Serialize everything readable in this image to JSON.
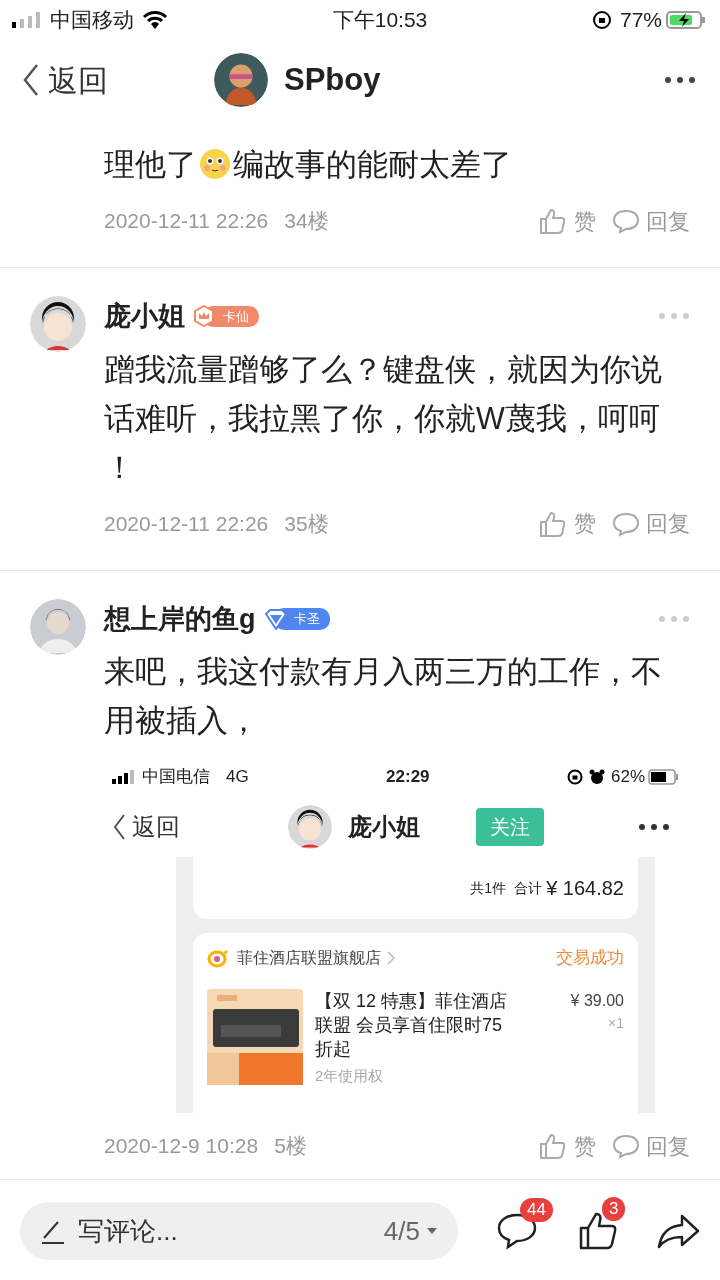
{
  "status_bar": {
    "carrier": "中国移动",
    "time": "下午10:53",
    "battery": "77%"
  },
  "header": {
    "back": "返回",
    "title": "SPboy"
  },
  "posts": [
    {
      "body": [
        {
          "kind": "text",
          "text": "理他了"
        },
        {
          "kind": "emoji"
        },
        {
          "kind": "text",
          "text": "编故事的能耐太差了"
        }
      ],
      "date": "2020-12-11 22:26",
      "floor": "34楼",
      "like": "赞",
      "reply": "回复"
    },
    {
      "user": {
        "name": "庞小姐",
        "avatar": {
          "kind": "cartoon"
        },
        "badge": {
          "label": "卡仙",
          "kind": "crown",
          "color": "#f08a6a"
        }
      },
      "body": [
        {
          "kind": "text",
          "text": "蹭我流量蹭够了么？键盘侠，就因为你说话难听，我拉黑了你，你就W蔑我，呵呵！"
        }
      ],
      "date": "2020-12-11 22:26",
      "floor": "35楼",
      "like": "赞",
      "reply": "回复"
    },
    {
      "user": {
        "name": "想上岸的鱼g",
        "badge": {
          "label": "卡圣",
          "kind": "diamond",
          "color": "#4f86f0"
        }
      },
      "body": [
        {
          "kind": "text",
          "text": "来吧，我这付款有月入两三万的工作，不用被插入，"
        }
      ],
      "screenshot": {
        "status": {
          "carrier": "中国电信",
          "network": "4G",
          "time": "22:29",
          "battery": "62%"
        },
        "nav": {
          "back": "返回",
          "title": "庞小姐",
          "follow": "关注"
        },
        "summary": {
          "count": "共1件",
          "total_label": "合计",
          "total": "¥ 164.82"
        },
        "order": {
          "store": "菲住酒店联盟旗舰店",
          "status": "交易成功",
          "title": "【双 12 特惠】菲住酒店联盟 会员享首住限时75折起",
          "price": "¥ 39.00",
          "qty": "×1",
          "spec": "2年使用权"
        }
      },
      "date": "2020-12-9 10:28",
      "floor": "5楼",
      "like": "赞",
      "reply": "回复"
    }
  ],
  "bottom_bar": {
    "placeholder": "写评论...",
    "page": "4/5",
    "comment_count": "44",
    "like_count": "3"
  }
}
